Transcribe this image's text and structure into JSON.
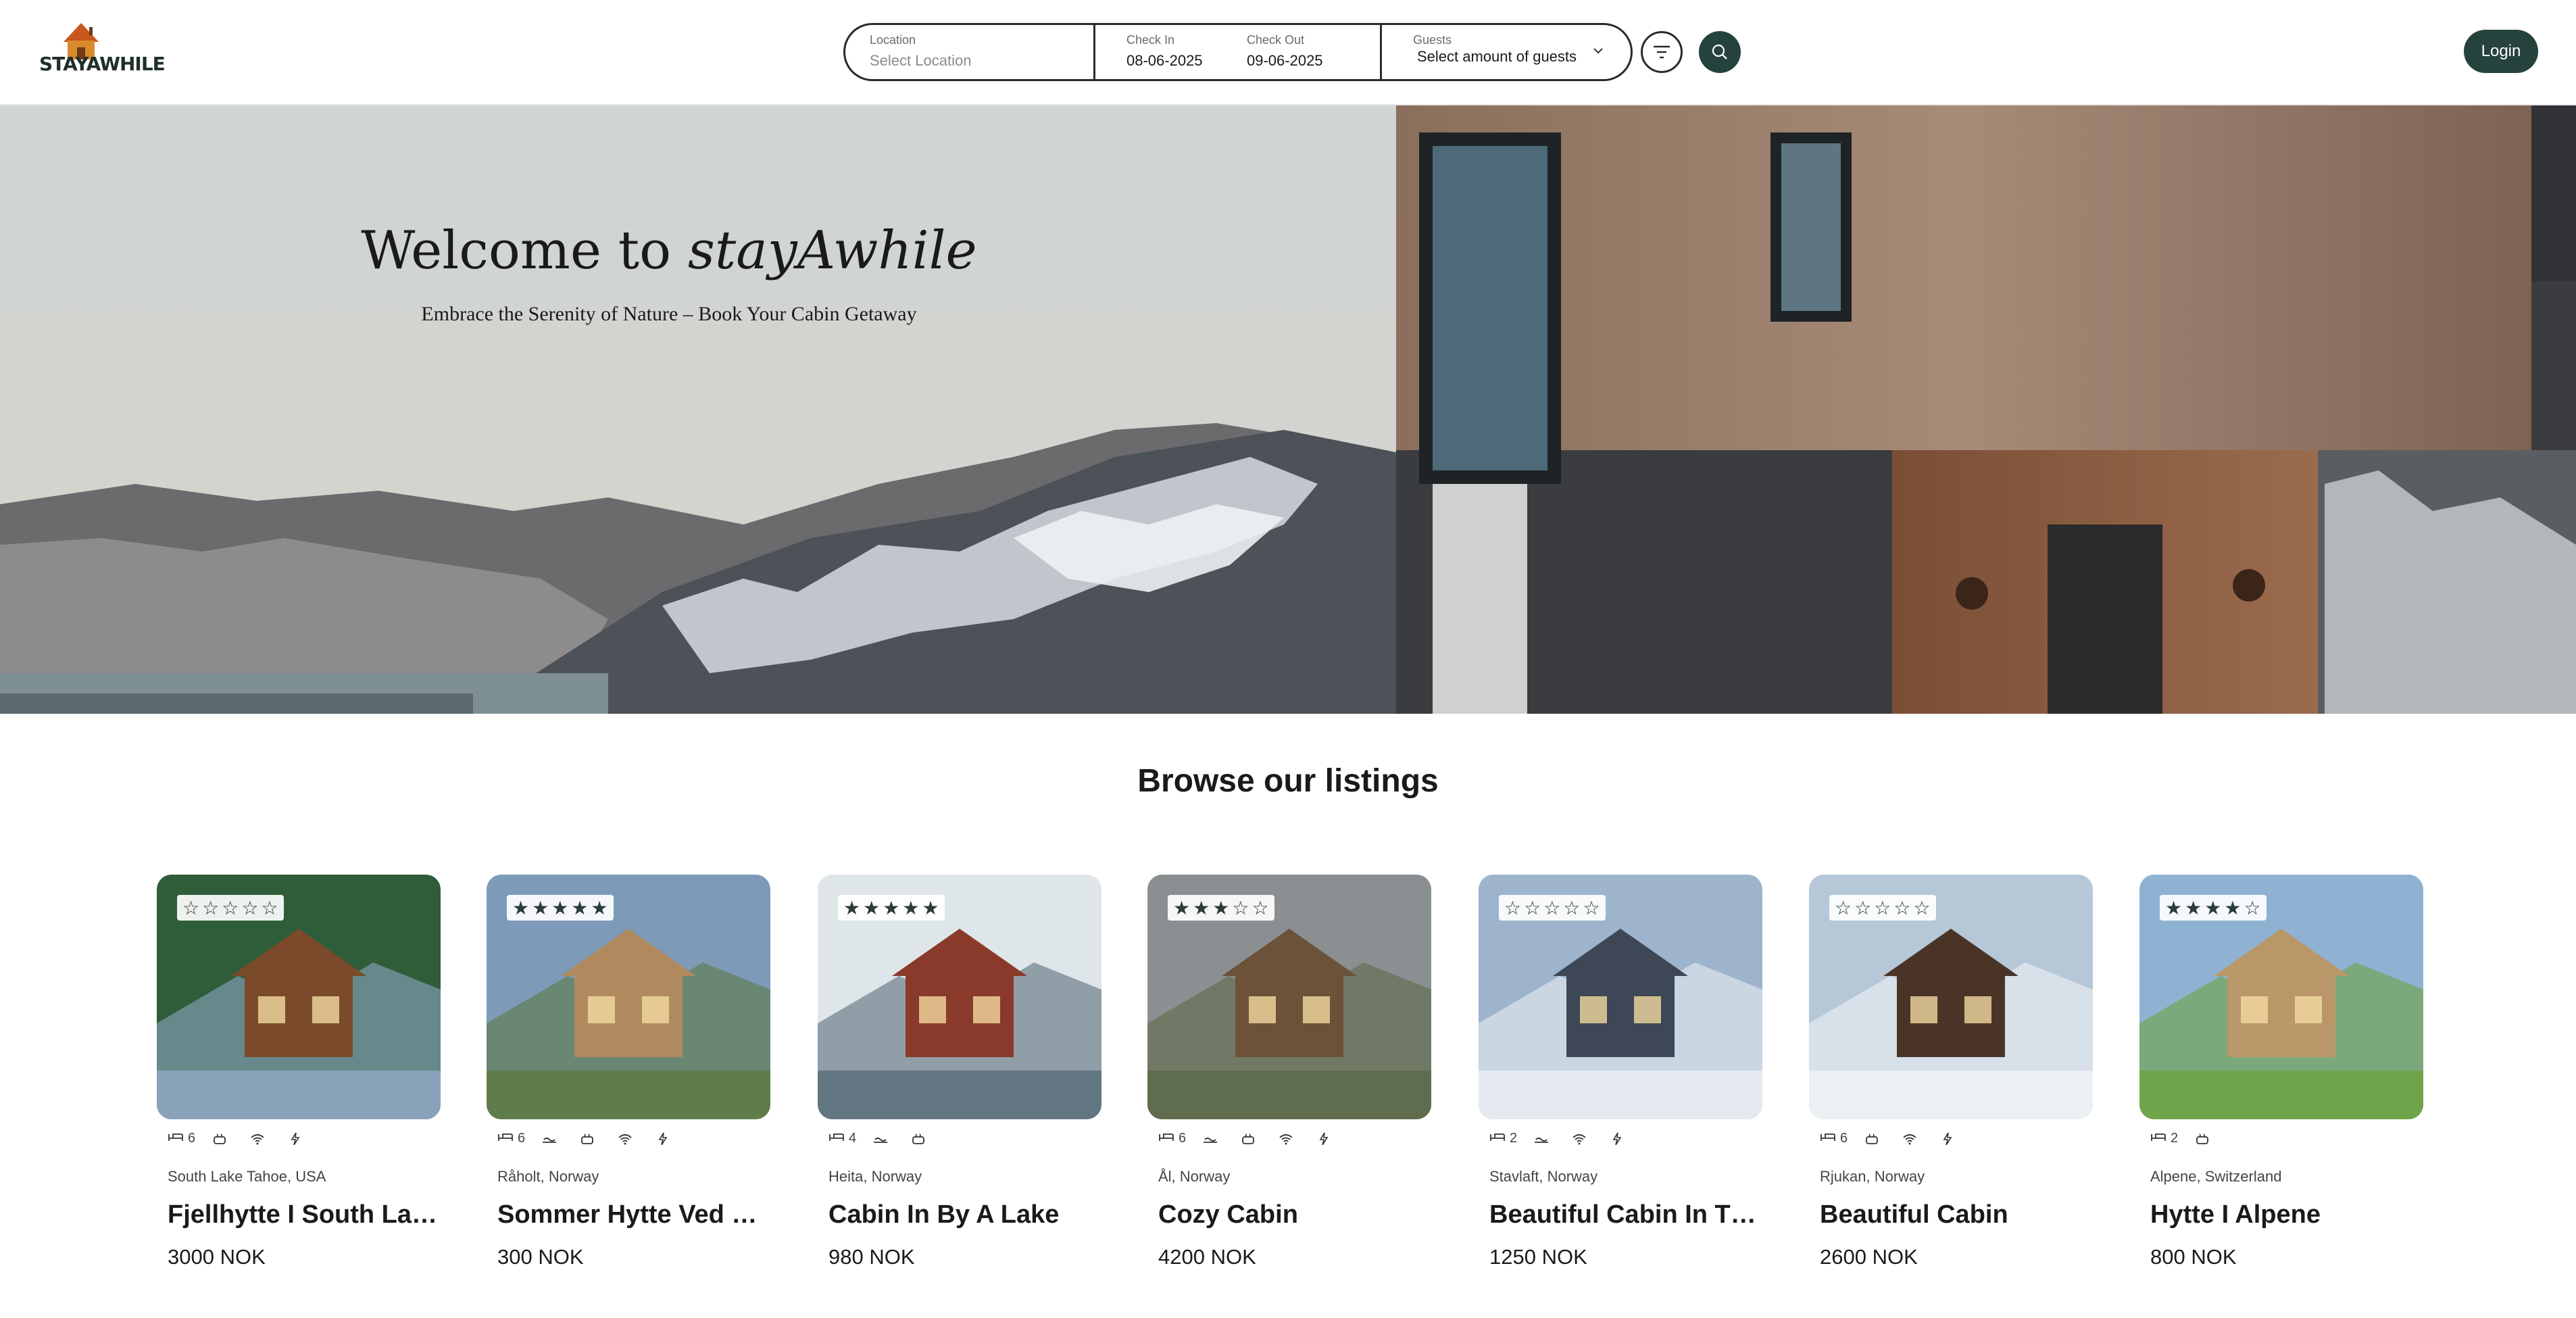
{
  "brand": {
    "name": "STAYAWHILE",
    "icon": "cabin-logo-icon"
  },
  "search": {
    "location_label": "Location",
    "location_placeholder": "Select Location",
    "checkin_label": "Check In",
    "checkin_value": "08-06-2025",
    "checkout_label": "Check Out",
    "checkout_value": "09-06-2025",
    "guests_label": "Guests",
    "guests_value": "Select amount of guests"
  },
  "header": {
    "login_label": "Login",
    "filter_icon": "filter-icon",
    "search_icon": "search-icon"
  },
  "hero": {
    "title_prefix": "Welcome to ",
    "title_brand": "stayAwhile",
    "subtitle": "Embrace the Serenity of Nature – Book Your Cabin Getaway"
  },
  "listings": {
    "heading": "Browse our listings",
    "items": [
      {
        "rating": 0,
        "beds": "6",
        "amenities": [
          "bed-icon",
          "hottub-icon",
          "wifi-icon",
          "electricity-icon"
        ],
        "location": "South Lake Tahoe, USA",
        "title": "Fjellhytte I South Lake Tahoe",
        "price": "3000 NOK"
      },
      {
        "rating": 5,
        "beds": "6",
        "amenities": [
          "bed-icon",
          "sauna-icon",
          "hottub-icon",
          "wifi-icon",
          "electricity-icon"
        ],
        "location": "Råholt, Norway",
        "title": "Sommer Hytte Ved Havet",
        "price": "300 NOK"
      },
      {
        "rating": 5,
        "beds": "4",
        "amenities": [
          "bed-icon",
          "sauna-icon",
          "hottub-icon"
        ],
        "location": "Heita, Norway",
        "title": "Cabin In By A Lake",
        "price": "980 NOK"
      },
      {
        "rating": 3,
        "beds": "6",
        "amenities": [
          "bed-icon",
          "sauna-icon",
          "hottub-icon",
          "wifi-icon",
          "electricity-icon"
        ],
        "location": "Ål, Norway",
        "title": "Cozy Cabin",
        "price": "4200 NOK"
      },
      {
        "rating": 0,
        "beds": "2",
        "amenities": [
          "bed-icon",
          "sauna-icon",
          "wifi-icon",
          "electricity-icon"
        ],
        "location": "Stavlaft, Norway",
        "title": "Beautiful Cabin In The Mountains",
        "price": "1250 NOK"
      },
      {
        "rating": 0,
        "beds": "6",
        "amenities": [
          "bed-icon",
          "hottub-icon",
          "wifi-icon",
          "electricity-icon"
        ],
        "location": "Rjukan, Norway",
        "title": "Beautiful Cabin",
        "price": "2600 NOK"
      },
      {
        "rating": 4,
        "beds": "2",
        "amenities": [
          "bed-icon",
          "hottub-icon"
        ],
        "location": "Alpene, Switzerland",
        "title": "Hytte I Alpene",
        "price": "800 NOK"
      }
    ]
  },
  "colors": {
    "accent": "#26423d",
    "border": "#2a2a2a"
  }
}
